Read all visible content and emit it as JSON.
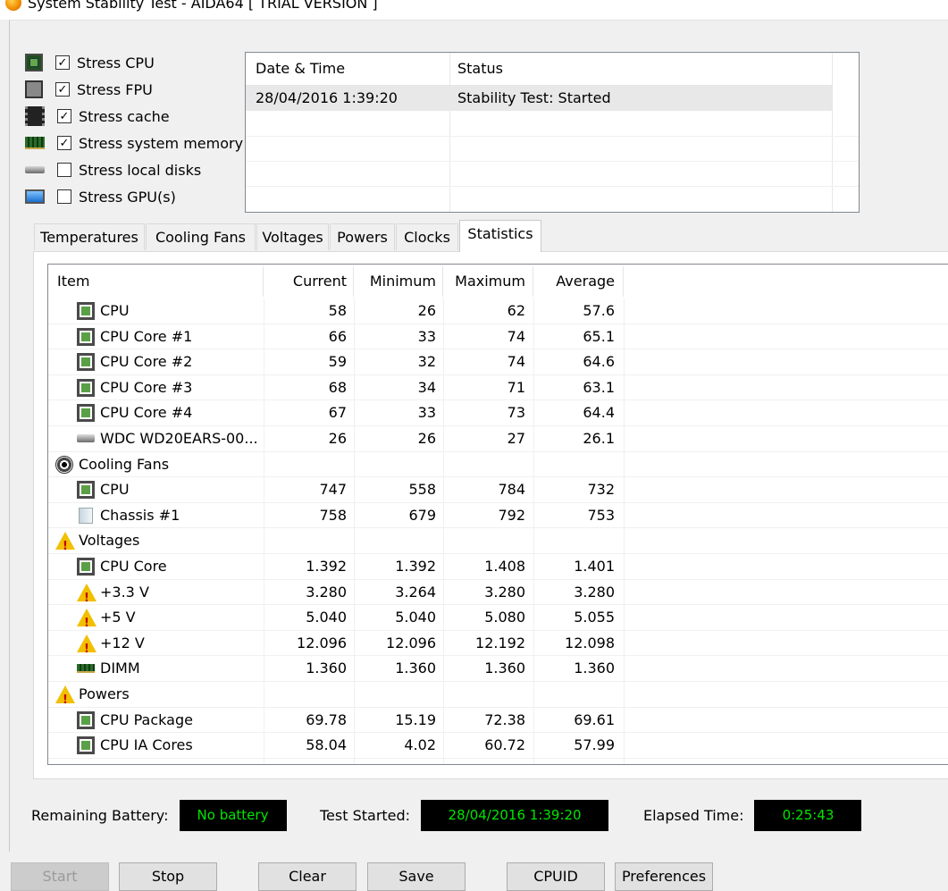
{
  "window": {
    "title": "System Stability Test - AIDA64  [ TRIAL VERSION ]"
  },
  "stress_options": [
    {
      "label": "Stress CPU",
      "checked": true,
      "icon": "cpu-icon"
    },
    {
      "label": "Stress FPU",
      "checked": true,
      "icon": "fpu-icon"
    },
    {
      "label": "Stress cache",
      "checked": true,
      "icon": "cache-icon"
    },
    {
      "label": "Stress system memory",
      "checked": true,
      "icon": "memory-icon"
    },
    {
      "label": "Stress local disks",
      "checked": false,
      "icon": "disk-icon"
    },
    {
      "label": "Stress GPU(s)",
      "checked": false,
      "icon": "gpu-icon"
    }
  ],
  "log": {
    "columns": [
      "Date & Time",
      "Status"
    ],
    "rows": [
      {
        "datetime": "28/04/2016 1:39:20",
        "status": "Stability Test: Started"
      }
    ]
  },
  "tabs": [
    "Temperatures",
    "Cooling Fans",
    "Voltages",
    "Powers",
    "Clocks",
    "Statistics"
  ],
  "active_tab": "Statistics",
  "stats": {
    "columns": [
      "Item",
      "Current",
      "Minimum",
      "Maximum",
      "Average"
    ],
    "rows": [
      {
        "item": "CPU",
        "icon": "cpu-icon",
        "child": true,
        "current": "58",
        "min": "26",
        "max": "62",
        "avg": "57.6"
      },
      {
        "item": "CPU Core #1",
        "icon": "cpu-icon",
        "child": true,
        "current": "66",
        "min": "33",
        "max": "74",
        "avg": "65.1"
      },
      {
        "item": "CPU Core #2",
        "icon": "cpu-icon",
        "child": true,
        "current": "59",
        "min": "32",
        "max": "74",
        "avg": "64.6"
      },
      {
        "item": "CPU Core #3",
        "icon": "cpu-icon",
        "child": true,
        "current": "68",
        "min": "34",
        "max": "71",
        "avg": "63.1"
      },
      {
        "item": "CPU Core #4",
        "icon": "cpu-icon",
        "child": true,
        "current": "67",
        "min": "33",
        "max": "73",
        "avg": "64.4"
      },
      {
        "item": "WDC WD20EARS-00...",
        "icon": "disk-icon",
        "child": true,
        "current": "26",
        "min": "26",
        "max": "27",
        "avg": "26.1"
      },
      {
        "item": "Cooling Fans",
        "icon": "fan-icon",
        "child": false,
        "current": "",
        "min": "",
        "max": "",
        "avg": ""
      },
      {
        "item": "CPU",
        "icon": "cpu-icon",
        "child": true,
        "current": "747",
        "min": "558",
        "max": "784",
        "avg": "732"
      },
      {
        "item": "Chassis #1",
        "icon": "chassis-icon",
        "child": true,
        "current": "758",
        "min": "679",
        "max": "792",
        "avg": "753"
      },
      {
        "item": "Voltages",
        "icon": "warning-icon",
        "child": false,
        "current": "",
        "min": "",
        "max": "",
        "avg": ""
      },
      {
        "item": "CPU Core",
        "icon": "cpu-icon",
        "child": true,
        "current": "1.392",
        "min": "1.392",
        "max": "1.408",
        "avg": "1.401"
      },
      {
        "item": "+3.3 V",
        "icon": "warning-icon",
        "child": true,
        "current": "3.280",
        "min": "3.264",
        "max": "3.280",
        "avg": "3.280"
      },
      {
        "item": "+5 V",
        "icon": "warning-icon",
        "child": true,
        "current": "5.040",
        "min": "5.040",
        "max": "5.080",
        "avg": "5.055"
      },
      {
        "item": "+12 V",
        "icon": "warning-icon",
        "child": true,
        "current": "12.096",
        "min": "12.096",
        "max": "12.192",
        "avg": "12.098"
      },
      {
        "item": "DIMM",
        "icon": "dimm-icon",
        "child": true,
        "current": "1.360",
        "min": "1.360",
        "max": "1.360",
        "avg": "1.360"
      },
      {
        "item": "Powers",
        "icon": "warning-icon",
        "child": false,
        "current": "",
        "min": "",
        "max": "",
        "avg": ""
      },
      {
        "item": "CPU Package",
        "icon": "cpu-icon",
        "child": true,
        "current": "69.78",
        "min": "15.19",
        "max": "72.38",
        "avg": "69.61"
      },
      {
        "item": "CPU IA Cores",
        "icon": "cpu-icon",
        "child": true,
        "current": "58.04",
        "min": "4.02",
        "max": "60.72",
        "avg": "57.99"
      }
    ]
  },
  "status": {
    "battery_label": "Remaining Battery:",
    "battery_value": "No battery",
    "started_label": "Test Started:",
    "started_value": "28/04/2016 1:39:20",
    "elapsed_label": "Elapsed Time:",
    "elapsed_value": "0:25:43"
  },
  "buttons": {
    "start": "Start",
    "stop": "Stop",
    "clear": "Clear",
    "save": "Save",
    "cpuid": "CPUID",
    "preferences": "Preferences"
  },
  "colors": {
    "status_text": "#00e600",
    "status_bg": "#000000",
    "row_highlight": "#e8e8e8"
  }
}
